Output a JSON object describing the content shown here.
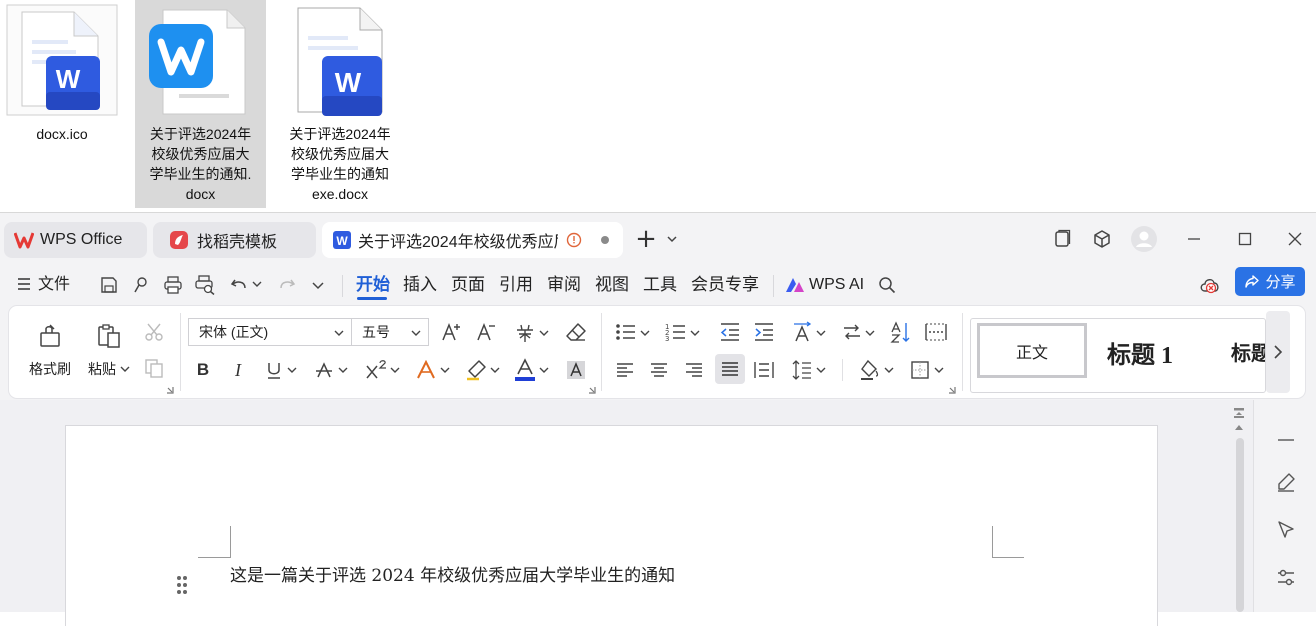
{
  "desktop": {
    "files": [
      {
        "name_lines": [
          "docx.ico"
        ],
        "selected": false
      },
      {
        "name_lines": [
          "关于评选2024年",
          "校级优秀应届大",
          "学毕业生的通知.",
          "docx"
        ],
        "selected": true
      },
      {
        "name_lines": [
          "关于评选2024年",
          "校级优秀应届大",
          "学毕业生的通知",
          "exe.docx"
        ],
        "selected": false
      }
    ]
  },
  "tabs": {
    "home": "WPS Office",
    "template": "找稻壳模板",
    "document": "关于评选2024年校级优秀应届",
    "new_tab": "+"
  },
  "menubar": {
    "file": "文件",
    "items": [
      "开始",
      "插入",
      "页面",
      "引用",
      "审阅",
      "视图",
      "工具",
      "会员专享"
    ],
    "ai": "WPS AI",
    "share": "分享"
  },
  "ribbon": {
    "format_painter": "格式刷",
    "paste": "粘贴",
    "font_name": "宋体 (正文)",
    "font_size": "五号",
    "styles": {
      "normal": "正文",
      "heading1": "标题  1",
      "heading2": "标题"
    }
  },
  "document": {
    "first_line": "这是一篇关于评选 2024 年校级优秀应届大学毕业生的通知"
  },
  "colors": {
    "accent": "#1f5fd6",
    "share_button": "#2a72e5",
    "wps_red": "#e53935",
    "word_blue": "#2f5be0"
  }
}
